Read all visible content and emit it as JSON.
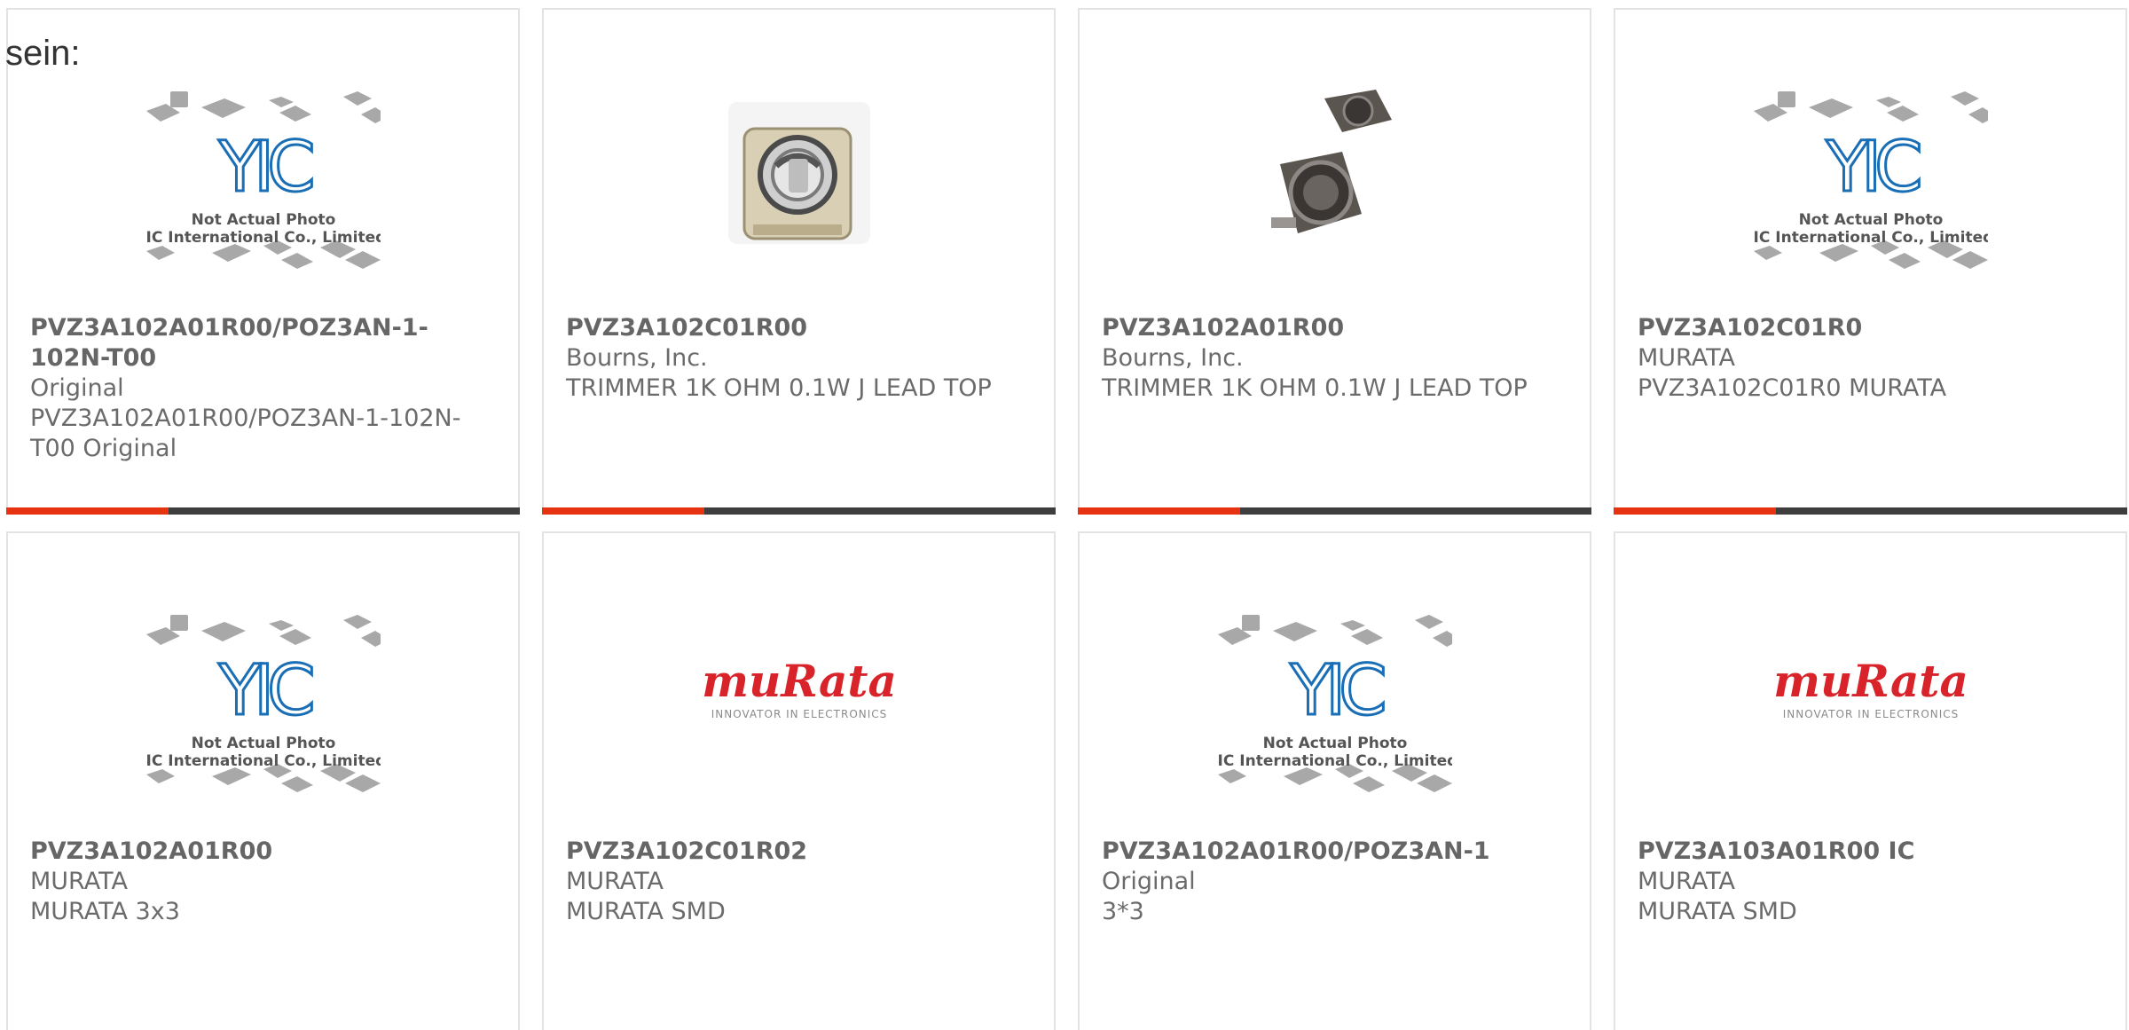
{
  "intro_text": "sein:",
  "colors": {
    "accent": "#e63312",
    "bar": "#3e3e3e",
    "border": "#e3e3e3",
    "text": "#6b6b6b",
    "murata_red": "#d8232a",
    "yic_blue": "#1a6eb5"
  },
  "placeholder": {
    "line1": "Not Actual Photo",
    "line2": "YIC International Co., Limited.",
    "logo": "YIC"
  },
  "murata": {
    "logo": "muRata",
    "tagline": "INNOVATOR IN ELECTRONICS"
  },
  "products": [
    {
      "part": "PVZ3A102A01R00/POZ3AN-1-102N-T00",
      "mfr": "Original",
      "desc": "PVZ3A102A01R00/POZ3AN-1-102N-T00 Original",
      "image": "yic-placeholder-icon"
    },
    {
      "part": "PVZ3A102C01R00",
      "mfr": "Bourns, Inc.",
      "desc": "TRIMMER 1K OHM 0.1W J LEAD TOP",
      "image": "trimmer-photo-icon"
    },
    {
      "part": "PVZ3A102A01R00",
      "mfr": "Bourns, Inc.",
      "desc": "TRIMMER 1K OHM 0.1W J LEAD TOP",
      "image": "trimmer-pair-photo-icon"
    },
    {
      "part": "PVZ3A102C01R0",
      "mfr": "MURATA",
      "desc": "PVZ3A102C01R0 MURATA",
      "image": "yic-placeholder-icon"
    },
    {
      "part": "PVZ3A102A01R00",
      "mfr": "MURATA",
      "desc": "MURATA 3x3",
      "image": "yic-placeholder-icon"
    },
    {
      "part": "PVZ3A102C01R02",
      "mfr": "MURATA",
      "desc": "MURATA SMD",
      "image": "murata-logo-icon"
    },
    {
      "part": "PVZ3A102A01R00/POZ3AN-1",
      "mfr": "Original",
      "desc": "3*3",
      "image": "yic-placeholder-icon"
    },
    {
      "part": "PVZ3A103A01R00 IC",
      "mfr": "MURATA",
      "desc": "MURATA SMD",
      "image": "murata-logo-icon"
    }
  ]
}
